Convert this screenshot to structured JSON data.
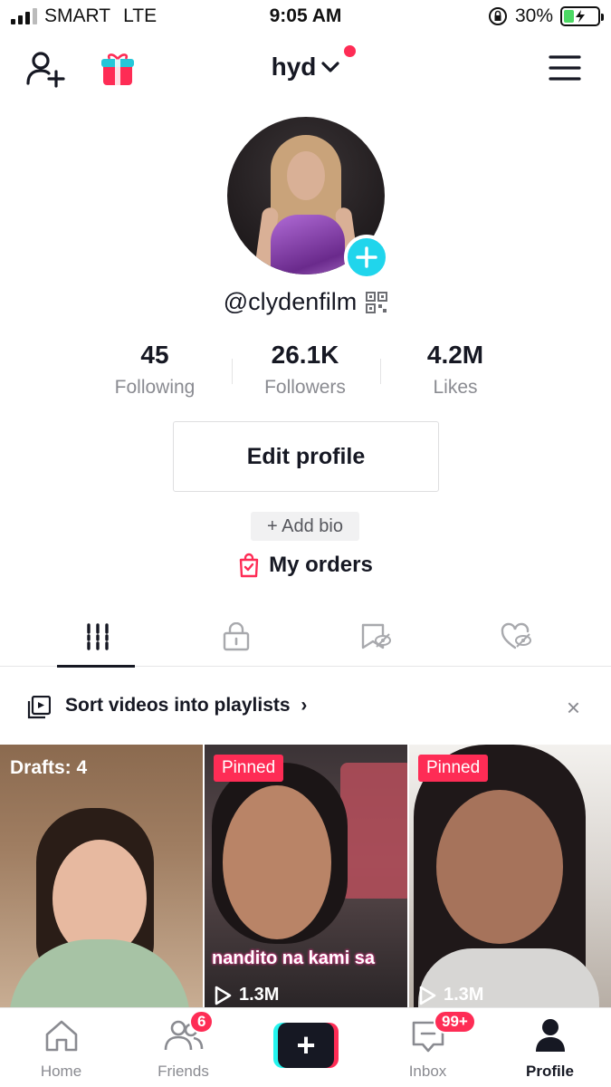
{
  "status_bar": {
    "carrier": "SMART",
    "network": "LTE",
    "time": "9:05 AM",
    "battery": "30%",
    "battery_level": 0.3
  },
  "header": {
    "username": "hyd",
    "icons": [
      "add-friend-icon",
      "gift-icon",
      "chevron-down-icon",
      "menu-icon"
    ]
  },
  "profile": {
    "handle": "@clydenfilm",
    "stats": [
      {
        "value": "45",
        "label": "Following"
      },
      {
        "value": "26.1K",
        "label": "Followers"
      },
      {
        "value": "4.2M",
        "label": "Likes"
      }
    ],
    "edit_profile": "Edit profile",
    "add_bio": "+ Add bio",
    "my_orders": "My orders"
  },
  "tabs": [
    "videos",
    "private",
    "favorites",
    "liked"
  ],
  "playlists_banner": {
    "text": "Sort videos into playlists",
    "close": "×"
  },
  "videos": [
    {
      "overlay": "Drafts: 4"
    },
    {
      "badge": "Pinned",
      "caption": "nandito na kami sa",
      "views": "1.3M"
    },
    {
      "badge": "Pinned",
      "views": "1.3M"
    }
  ],
  "bottom_nav": [
    {
      "label": "Home"
    },
    {
      "label": "Friends",
      "badge": "6"
    },
    {
      "label": "",
      "icon": "plus-icon"
    },
    {
      "label": "Inbox",
      "badge": "99+"
    },
    {
      "label": "Profile"
    }
  ],
  "colors": {
    "accent": "#fe2c55",
    "cyan": "#25f4ee",
    "text": "#161823",
    "muted": "#8a8b91"
  }
}
